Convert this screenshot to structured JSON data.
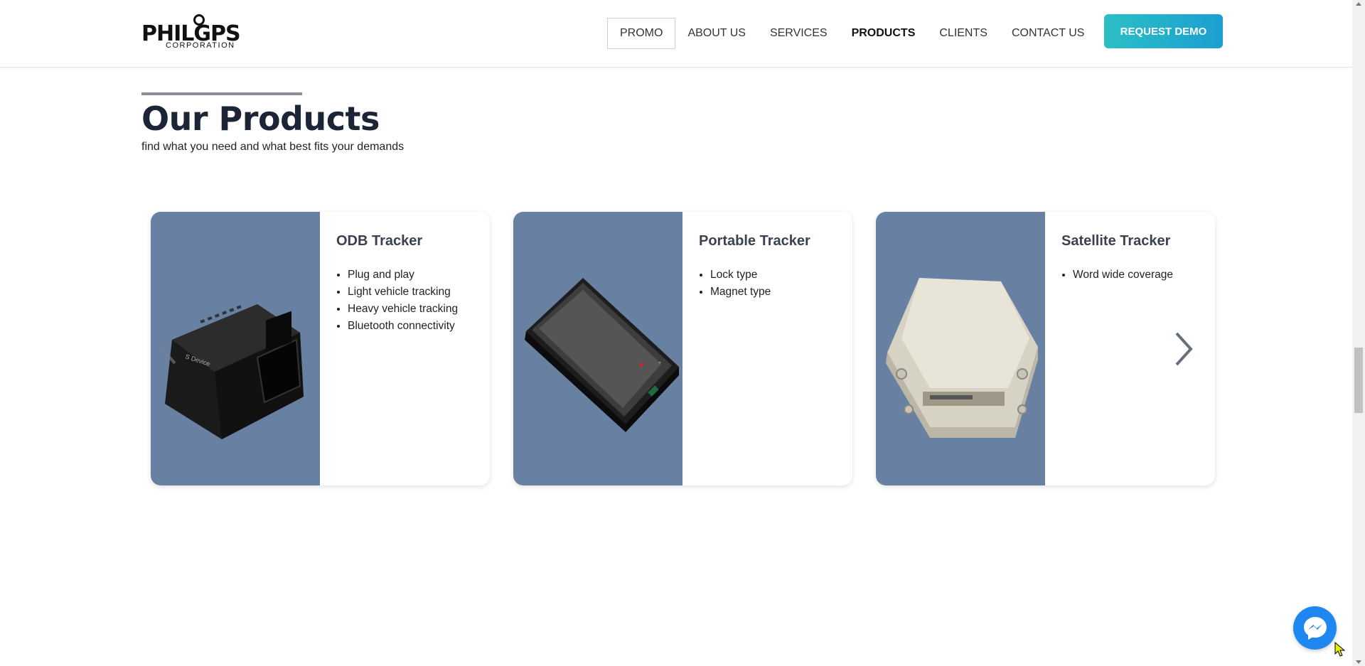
{
  "header": {
    "logo": {
      "main": "PHILGPS",
      "sub": "CORPORATION"
    },
    "nav": [
      {
        "label": "PROMO"
      },
      {
        "label": "ABOUT US"
      },
      {
        "label": "SERVICES"
      },
      {
        "label": "PRODUCTS"
      },
      {
        "label": "CLIENTS"
      },
      {
        "label": "CONTACT US"
      }
    ],
    "cta_label": "REQUEST DEMO",
    "cta_color": "#20b0cc"
  },
  "section": {
    "title": "Our Products",
    "subtitle": "find what you need and what best fits your demands"
  },
  "products": [
    {
      "name": "ODB Tracker",
      "features": [
        "Plug and play",
        "Light vehicle tracking",
        "Heavy vehicle tracking",
        "Bluetooth connectivity"
      ],
      "image_icon": "obd-device-image",
      "device_label": "S Device"
    },
    {
      "name": "Portable Tracker",
      "features": [
        "Lock type",
        "Magnet type"
      ],
      "image_icon": "portable-tracker-image"
    },
    {
      "name": "Satellite Tracker",
      "features": [
        "Word wide coverage"
      ],
      "image_icon": "satellite-tracker-image"
    }
  ],
  "colors": {
    "card_image_bg": "#6880a2",
    "title_color": "#1b2536",
    "messenger_blue": "#1e88f0"
  },
  "widgets": {
    "prev_icon": "chevron-left-icon",
    "next_icon": "chevron-right-icon",
    "chat_icon": "messenger-icon"
  }
}
